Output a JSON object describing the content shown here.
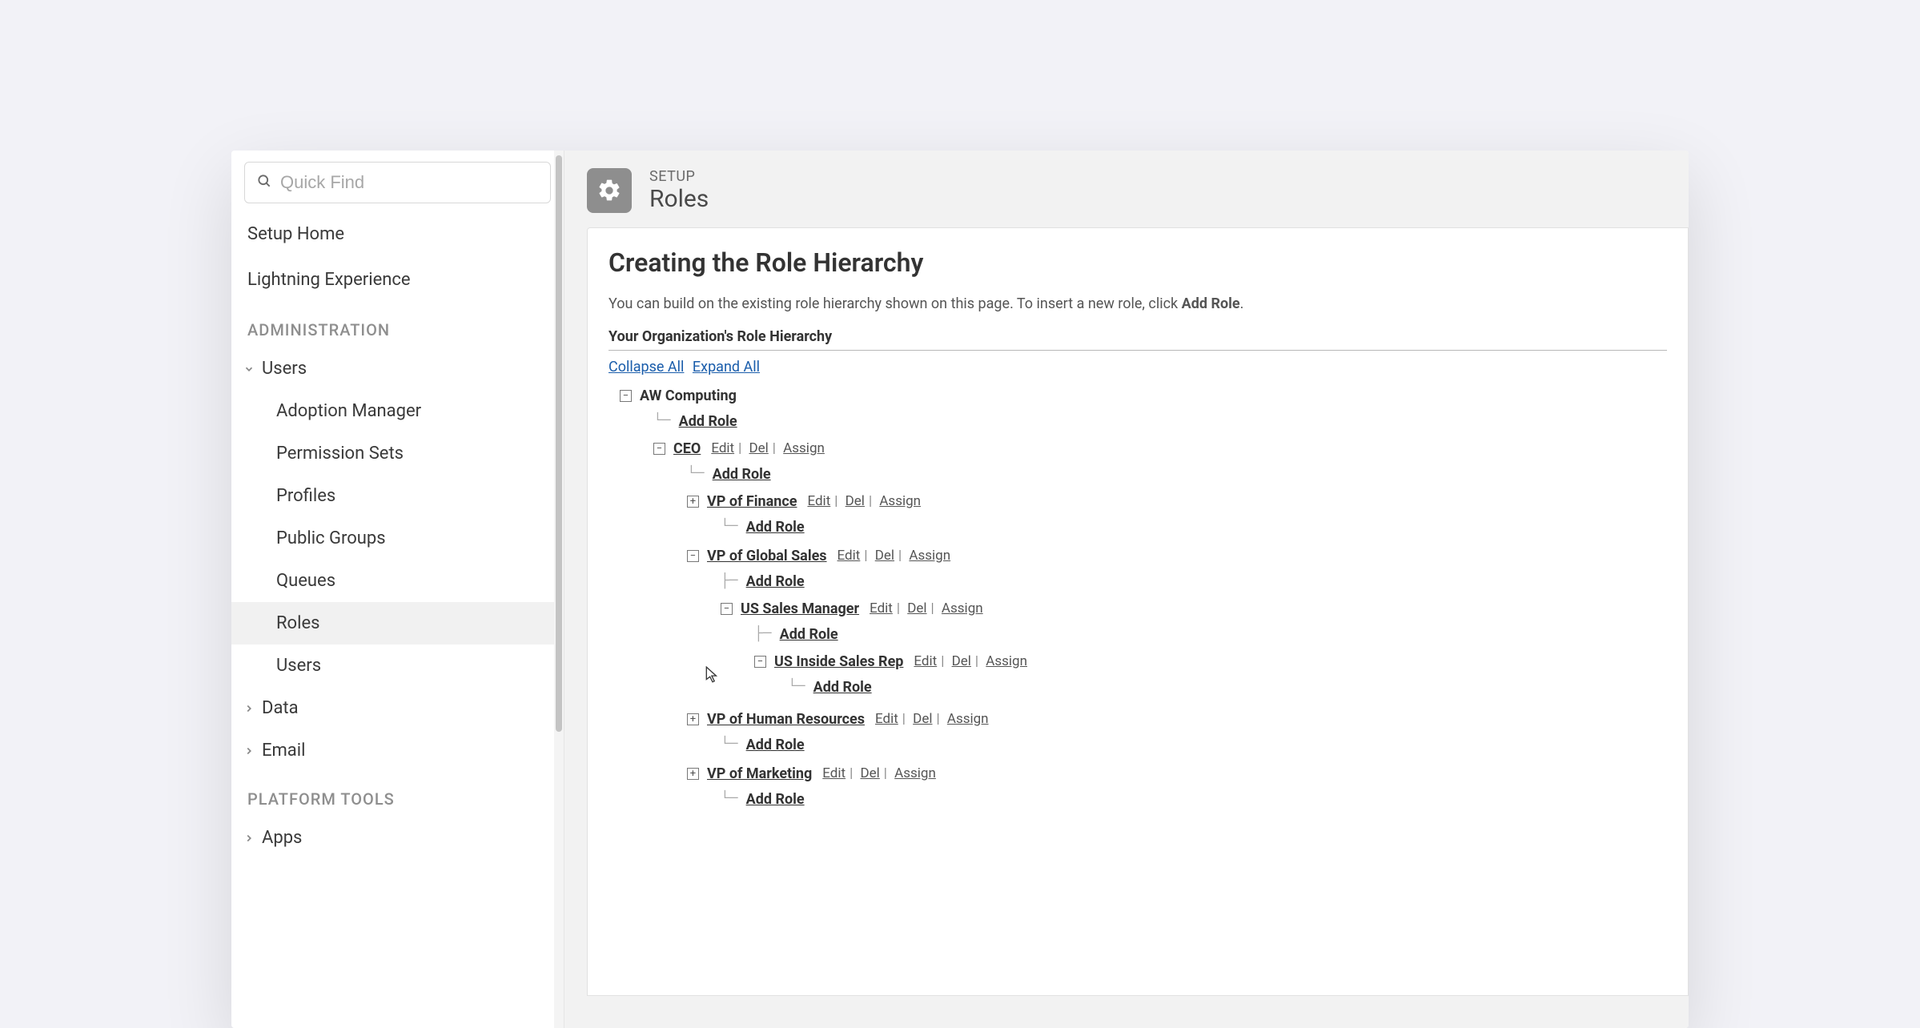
{
  "search": {
    "placeholder": "Quick Find"
  },
  "sidebar": {
    "link_setup_home": "Setup Home",
    "link_lightning": "Lightning Experience",
    "heading_admin": "ADMINISTRATION",
    "users_label": "Users",
    "users_children": {
      "adoption": "Adoption Manager",
      "permission": "Permission Sets",
      "profiles": "Profiles",
      "public_groups": "Public Groups",
      "queues": "Queues",
      "roles": "Roles",
      "users": "Users"
    },
    "data_label": "Data",
    "email_label": "Email",
    "heading_platform": "PLATFORM TOOLS",
    "apps_label": "Apps"
  },
  "header": {
    "eyebrow": "SETUP",
    "title": "Roles"
  },
  "content": {
    "page_title": "Creating the Role Hierarchy",
    "desc_pre": "You can build on the existing role hierarchy shown on this page. To insert a new role, click ",
    "desc_bold": "Add Role",
    "desc_post": ".",
    "subheading": "Your Organization's Role Hierarchy",
    "collapse": "Collapse All",
    "expand": "Expand All",
    "add_role": "Add Role",
    "actions": {
      "edit": "Edit",
      "del": "Del",
      "assign": "Assign"
    },
    "roles": {
      "org": "AW Computing",
      "ceo": "CEO",
      "vp_finance": "VP of Finance",
      "vp_global_sales": "VP of Global Sales",
      "us_sales_mgr": "US Sales Manager",
      "us_inside_rep": "US Inside Sales Rep",
      "vp_hr": "VP of Human Resources",
      "vp_marketing": "VP of Marketing"
    }
  }
}
